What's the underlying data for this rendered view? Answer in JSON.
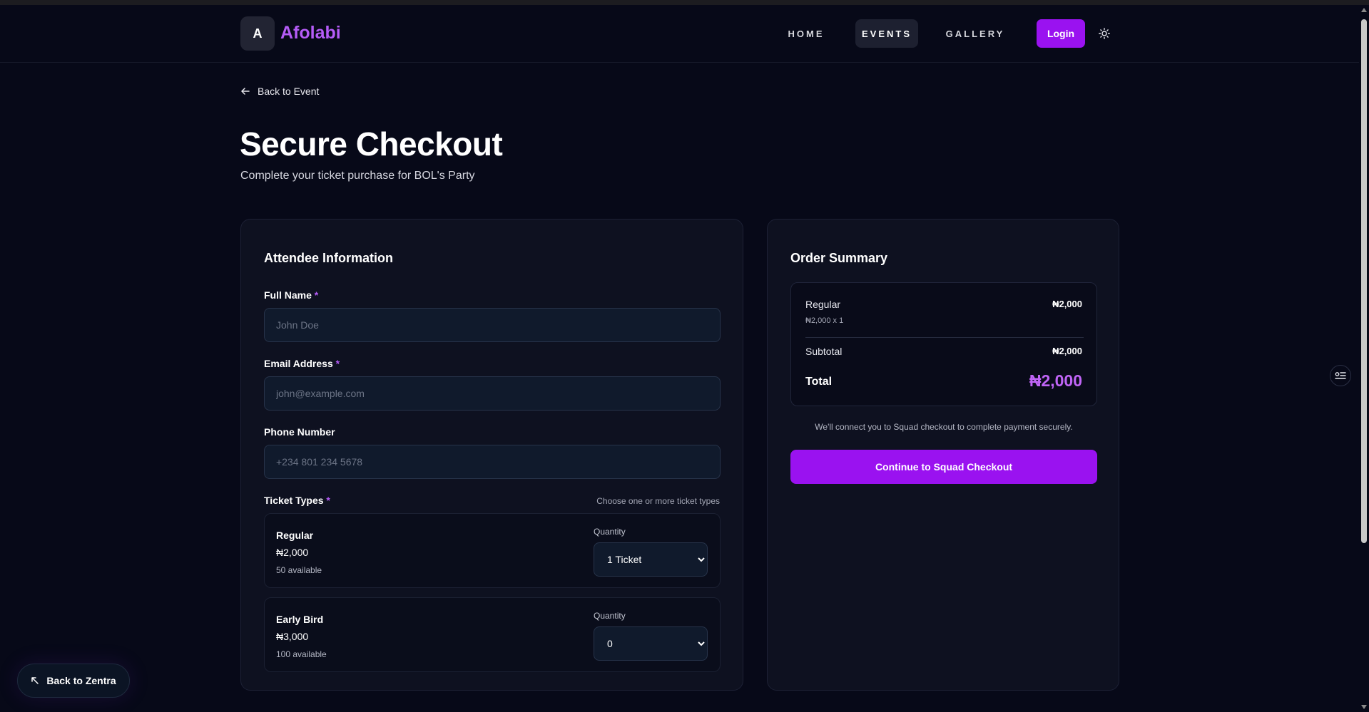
{
  "brand": {
    "logo_letter": "A",
    "name": "Afolabi",
    "accent": "#9a12f0"
  },
  "nav": {
    "home": "HOME",
    "events": "EVENTS",
    "gallery": "GALLERY",
    "login": "Login"
  },
  "back_link": "Back to Event",
  "title": "Secure Checkout",
  "subtitle": "Complete your ticket purchase for BOL's Party",
  "attendee": {
    "heading": "Attendee Information",
    "full_name": {
      "label": "Full Name",
      "placeholder": "John Doe",
      "value": ""
    },
    "email": {
      "label": "Email Address",
      "placeholder": "john@example.com",
      "value": ""
    },
    "phone": {
      "label": "Phone Number",
      "placeholder": "+234 801 234 5678",
      "value": ""
    },
    "required_mark": "*"
  },
  "tickets": {
    "label": "Ticket Types",
    "hint": "Choose one or more ticket types",
    "quantity_label": "Quantity",
    "items": [
      {
        "name": "Regular",
        "price": "₦2,000",
        "availability": "50 available",
        "quantity": "1 Ticket"
      },
      {
        "name": "Early Bird",
        "price": "₦3,000",
        "availability": "100 available",
        "quantity": "0"
      }
    ]
  },
  "summary": {
    "heading": "Order Summary",
    "item_name": "Regular",
    "item_detail": "₦2,000 x 1",
    "item_price": "₦2,000",
    "subtotal_label": "Subtotal",
    "subtotal_value": "₦2,000",
    "total_label": "Total",
    "total_value": "₦2,000",
    "note": "We'll connect you to Squad checkout to complete payment securely.",
    "checkout_button": "Continue to Squad Checkout"
  },
  "back_zentra": "Back to Zentra"
}
